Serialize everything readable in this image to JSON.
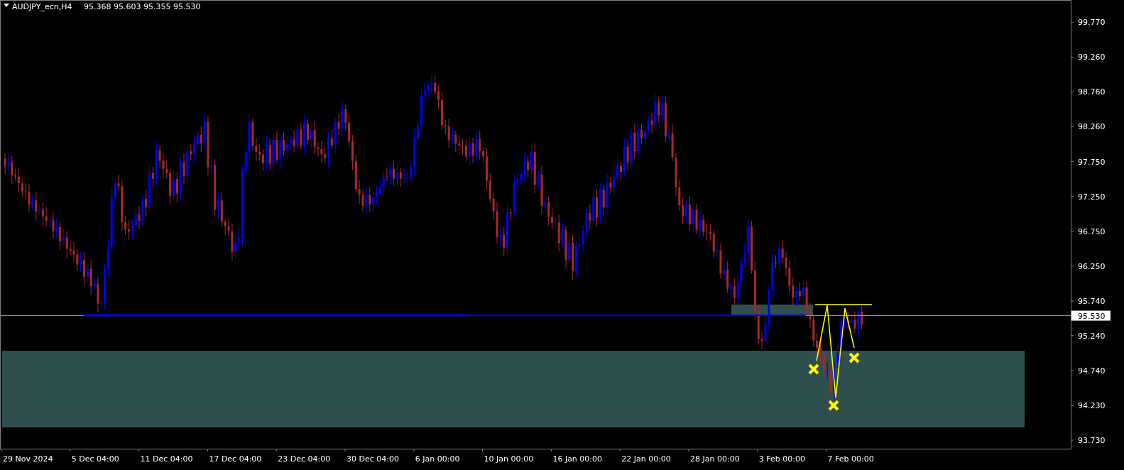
{
  "header": {
    "symbol": "AUDJPY_ecn,H4",
    "ohlc": "95.368 95.603 95.355 95.530"
  },
  "price_axis": {
    "labels": [
      "99.770",
      "99.260",
      "98.760",
      "98.260",
      "97.750",
      "97.250",
      "96.750",
      "96.250",
      "95.740",
      "95.240",
      "94.740",
      "94.230",
      "93.730"
    ],
    "current_price": "95.530"
  },
  "time_axis": {
    "labels": [
      "29 Nov 2024",
      "5 Dec 04:00",
      "11 Dec 04:00",
      "17 Dec 04:00",
      "23 Dec 04:00",
      "30 Dec 04:00",
      "6 Jan 00:00",
      "10 Jan 00:00",
      "16 Jan 00:00",
      "22 Jan 00:00",
      "28 Jan 00:00",
      "3 Feb 00:00",
      "7 Feb 00:00"
    ]
  }
}
